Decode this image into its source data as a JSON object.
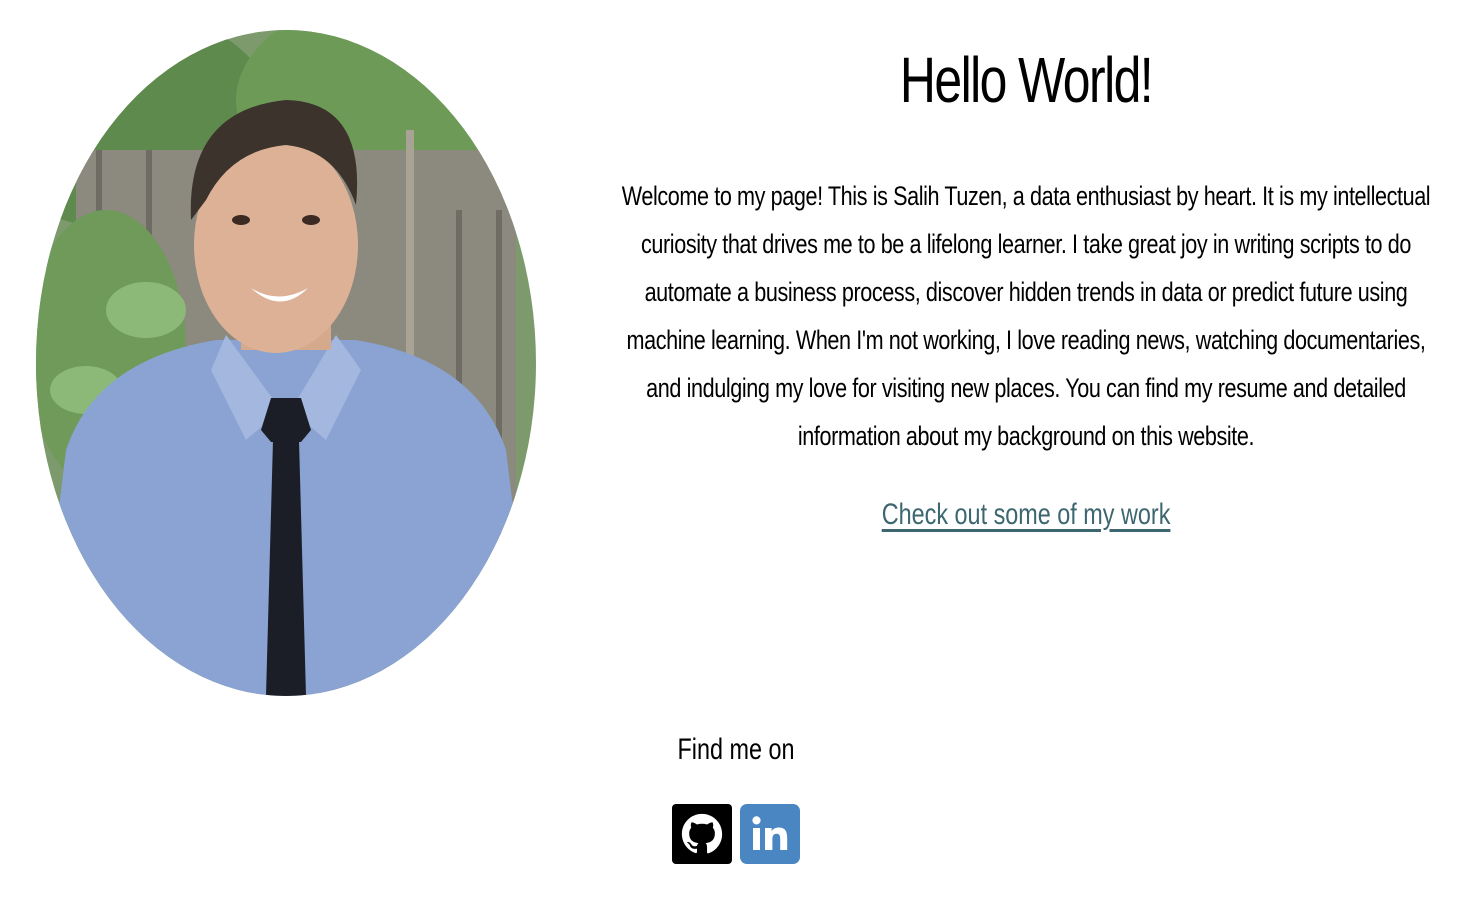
{
  "hero": {
    "title": "Hello World!",
    "bio": "Welcome to my page! This is Salih Tuzen, a data enthusiast by heart. It is my intellectual curiosity that drives me to be a lifelong learner. I take great joy in writing scripts to do automate a business process, discover hidden trends in data or predict future using machine learning. When I'm not working, I love reading news, watching documentaries, and indulging my love for visiting new places. You can find my resume and detailed information about my background on this website.",
    "work_link": "Check out some of my work"
  },
  "social": {
    "heading": "Find me on",
    "items": [
      {
        "icon": "github-icon",
        "color": "#000000"
      },
      {
        "icon": "linkedin-icon",
        "color": "#4a86c1"
      }
    ]
  },
  "colors": {
    "link": "#3c6670",
    "background": "#ffffff"
  }
}
